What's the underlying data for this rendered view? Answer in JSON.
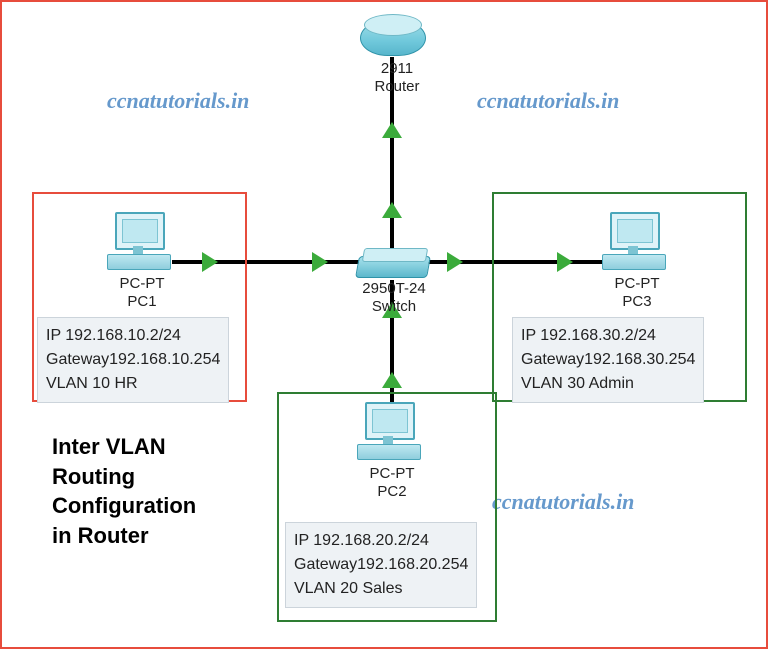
{
  "watermarks": {
    "top_left": "ccnatutorials.in",
    "top_right": "ccnatutorials.in",
    "bottom_right": "ccnatutorials.in"
  },
  "title": "Inter VLAN\nRouting\nConfiguration\nin Router",
  "router": {
    "model": "2911",
    "label": "Router"
  },
  "switch": {
    "model": "2950T-24",
    "label": "Switch"
  },
  "pcs": {
    "pc1": {
      "type": "PC-PT",
      "name": "PC1",
      "ip": "IP 192.168.10.2/24",
      "gateway": "Gateway192.168.10.254",
      "vlan": "VLAN 10 HR"
    },
    "pc2": {
      "type": "PC-PT",
      "name": "PC2",
      "ip": "IP 192.168.20.2/24",
      "gateway": "Gateway192.168.20.254",
      "vlan": "VLAN 20 Sales"
    },
    "pc3": {
      "type": "PC-PT",
      "name": "PC3",
      "ip": "IP 192.168.30.2/24",
      "gateway": "Gateway192.168.30.254",
      "vlan": "VLAN 30 Admin"
    }
  },
  "chart_data": {
    "type": "table",
    "title": "Inter VLAN Routing Configuration in Router",
    "nodes": [
      {
        "id": "Router",
        "model": "2911",
        "kind": "router"
      },
      {
        "id": "Switch",
        "model": "2950T-24",
        "kind": "switch"
      },
      {
        "id": "PC1",
        "kind": "pc",
        "vlan_id": 10,
        "vlan_name": "HR",
        "ip": "192.168.10.2",
        "mask": 24,
        "gateway": "192.168.10.254"
      },
      {
        "id": "PC2",
        "kind": "pc",
        "vlan_id": 20,
        "vlan_name": "Sales",
        "ip": "192.168.20.2",
        "mask": 24,
        "gateway": "192.168.20.254"
      },
      {
        "id": "PC3",
        "kind": "pc",
        "vlan_id": 30,
        "vlan_name": "Admin",
        "ip": "192.168.30.2",
        "mask": 24,
        "gateway": "192.168.30.254"
      }
    ],
    "links": [
      {
        "from": "Router",
        "to": "Switch",
        "status": "up"
      },
      {
        "from": "PC1",
        "to": "Switch",
        "status": "up"
      },
      {
        "from": "PC2",
        "to": "Switch",
        "status": "up"
      },
      {
        "from": "PC3",
        "to": "Switch",
        "status": "up"
      }
    ]
  }
}
